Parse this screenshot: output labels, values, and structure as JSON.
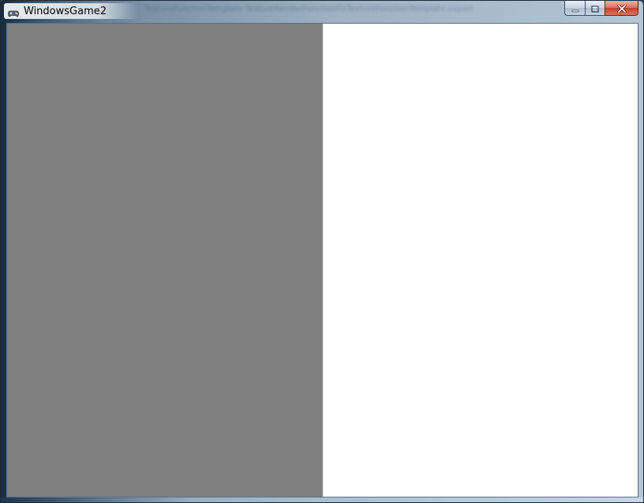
{
  "window": {
    "title": "WindowsGame2",
    "background_text": "TextureFunctionTemplate TextureRenderFunctionFixTextureFunctionTemplate export"
  },
  "caption_buttons": {
    "minimize": "minimize",
    "maximize": "maximize",
    "close": "close"
  },
  "client": {
    "left_panel_color": "#808080",
    "right_panel_color": "#ffffff"
  },
  "icons": {
    "app": "gamepad-icon",
    "minimize": "minimize-icon",
    "maximize": "maximize-icon",
    "close": "close-icon"
  }
}
